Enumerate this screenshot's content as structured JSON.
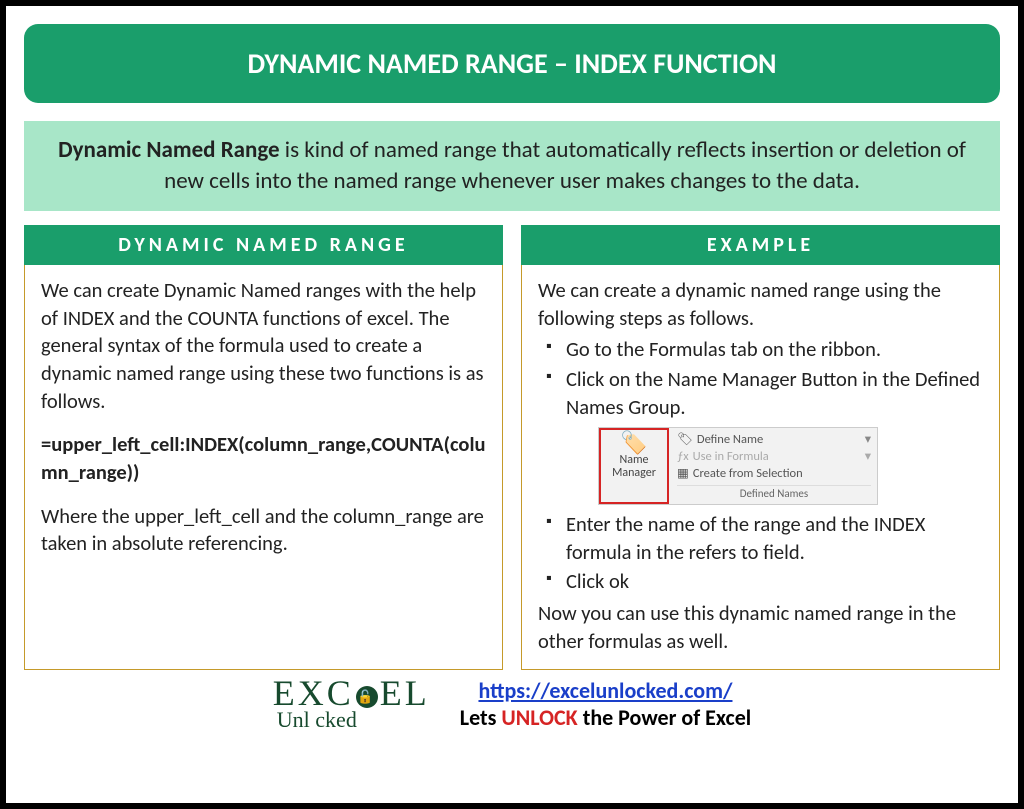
{
  "title": "DYNAMIC NAMED RANGE – INDEX FUNCTION",
  "intro": {
    "bold": "Dynamic Named Range",
    "rest": " is kind of named range that automatically reflects insertion or deletion of new cells into the named range whenever user makes changes to the data."
  },
  "left": {
    "header": "DYNAMIC NAMED RANGE",
    "p1": "We can create Dynamic Named ranges with the help of INDEX and the COUNTA functions of excel. The general syntax of the formula used to create a dynamic named range using these two functions is as follows.",
    "formula": "=upper_left_cell:INDEX(column_range,COUNTA(column_range))",
    "p2": "Where the upper_left_cell and the column_range are taken in absolute referencing."
  },
  "right": {
    "header": "EXAMPLE",
    "p1": "We can create a dynamic named range using the following steps as follows.",
    "steps_a": [
      "Go to the Formulas tab on the ribbon.",
      "Click on the Name Manager Button in the Defined Names Group."
    ],
    "ribbon": {
      "manager": "Name Manager",
      "define": "Define Name",
      "use": "Use in Formula",
      "create": "Create from Selection",
      "group": "Defined Names"
    },
    "steps_b": [
      "Enter the name of the range and the INDEX formula in the refers to field.",
      "Click ok"
    ],
    "p2": "Now you can use this dynamic named range in the other formulas as well."
  },
  "footer": {
    "logo_top_1": "EXC",
    "logo_top_2": "EL",
    "logo_bottom": "Unl  cked",
    "url": "https://excelunlocked.com/",
    "tag_1": "Lets ",
    "tag_unlock": "UNLOCK",
    "tag_2": " the Power of Excel"
  }
}
